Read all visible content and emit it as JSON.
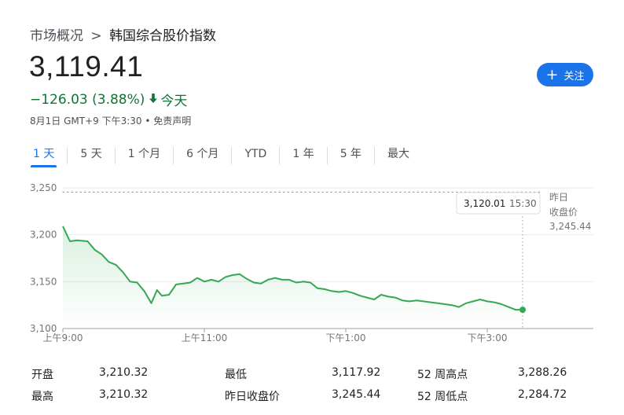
{
  "breadcrumb": {
    "parent": "市场概况",
    "separator": ">",
    "current": "韩国综合股价指数"
  },
  "quote": {
    "price": "3,119.41",
    "change": "−126.03 (3.88%)",
    "direction_icon": "arrow-down-icon",
    "period": "今天",
    "meta": "8月1日 GMT+9 下午3:30 • 免责声明",
    "change_color": "#137333"
  },
  "follow_button": {
    "icon": "plus-icon",
    "label": "关注",
    "color": "#1a73e8"
  },
  "tabs": [
    {
      "label": "1 天",
      "active": true
    },
    {
      "label": "5 天",
      "active": false
    },
    {
      "label": "1 个月",
      "active": false
    },
    {
      "label": "6 个月",
      "active": false
    },
    {
      "label": "YTD",
      "active": false
    },
    {
      "label": "1 年",
      "active": false
    },
    {
      "label": "5 年",
      "active": false
    },
    {
      "label": "最大",
      "active": false
    }
  ],
  "chart_data": {
    "type": "line",
    "y_ticks": [
      "3,250",
      "3,200",
      "3,150",
      "3,100"
    ],
    "y_tick_values": [
      3250,
      3200,
      3150,
      3100
    ],
    "ylim": [
      3100,
      3250
    ],
    "x_ticks": [
      "上午9:00",
      "上午11:00",
      "下午1:00",
      "下午3:00"
    ],
    "x_tick_hours": [
      9,
      11,
      13,
      15
    ],
    "x_range_hours": [
      9,
      16.5
    ],
    "grid": true,
    "line_color": "#34a853",
    "previous_close": {
      "label_line1": "昨日",
      "label_line2": "收盘价",
      "value": 3245.44,
      "value_text": "3,245.44"
    },
    "tooltip": {
      "value": "3,120.01",
      "time": "15:30"
    },
    "series": [
      {
        "x": [
          9.0,
          9.1,
          9.2,
          9.35,
          9.45,
          9.55,
          9.65,
          9.75,
          9.85,
          9.95,
          10.05,
          10.15,
          10.25,
          10.33,
          10.4,
          10.5,
          10.6,
          10.7,
          10.8,
          10.9,
          11.0,
          11.1,
          11.2,
          11.3,
          11.4,
          11.5,
          11.6,
          11.7,
          11.8,
          11.9,
          12.0,
          12.1,
          12.2,
          12.3,
          12.4,
          12.5,
          12.6,
          12.7,
          12.8,
          12.9,
          13.0,
          13.1,
          13.2,
          13.3,
          13.4,
          13.5,
          13.6,
          13.7,
          13.8,
          13.9,
          14.0,
          14.1,
          14.2,
          14.3,
          14.4,
          14.5,
          14.6,
          14.7,
          14.8,
          14.9,
          15.0,
          15.1,
          15.2,
          15.3,
          15.4,
          15.5
        ],
        "y": [
          3209,
          3193,
          3194,
          3193,
          3184,
          3179,
          3171,
          3168,
          3160,
          3150,
          3149,
          3140,
          3127,
          3141,
          3135,
          3136,
          3147,
          3148,
          3149,
          3154,
          3150,
          3152,
          3150,
          3155,
          3157,
          3158,
          3153,
          3149,
          3148,
          3152,
          3154,
          3152,
          3152,
          3149,
          3150,
          3149,
          3143,
          3142,
          3140,
          3139,
          3140,
          3138,
          3135,
          3133,
          3131,
          3136,
          3134,
          3133,
          3130,
          3129,
          3130,
          3129,
          3128,
          3127,
          3126,
          3125,
          3123,
          3127,
          3129,
          3131,
          3129,
          3128,
          3126,
          3123,
          3120,
          3120
        ]
      }
    ]
  },
  "stats": [
    {
      "label": "开盘",
      "value": "3,210.32"
    },
    {
      "label": "最高",
      "value": "3,210.32"
    },
    {
      "label": "最低",
      "value": "3,117.92"
    },
    {
      "label": "昨日收盘价",
      "value": "3,245.44"
    },
    {
      "label": "52 周高点",
      "value": "3,288.26"
    },
    {
      "label": "52 周低点",
      "value": "2,284.72"
    }
  ]
}
